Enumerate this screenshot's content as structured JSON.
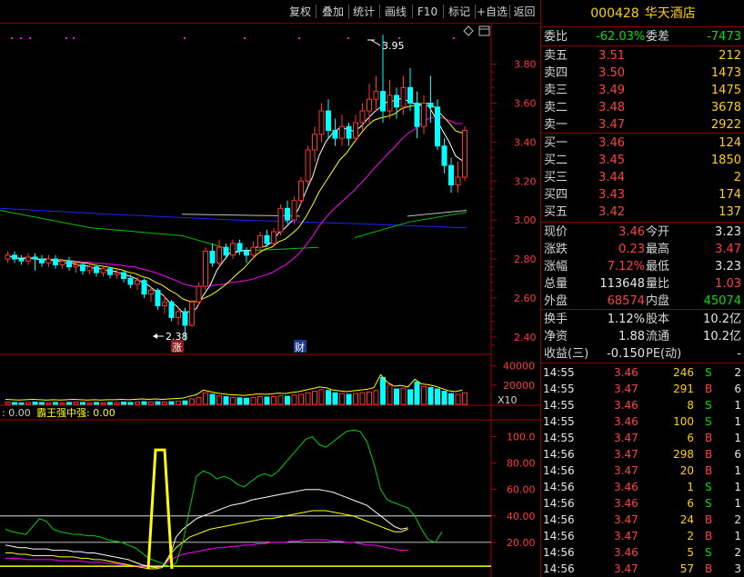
{
  "toolbar": {
    "buttons": [
      "复权",
      "叠加",
      "统计",
      "画线",
      "F10",
      "标记",
      "+自选",
      "返回"
    ]
  },
  "chart": {
    "price_axis": [
      "3.80",
      "3.60",
      "3.40",
      "3.20",
      "3.00",
      "2.80",
      "2.60",
      "2.40"
    ],
    "high_label": "3.95",
    "low_label": "2.38",
    "event_marks": [
      "涨",
      "财"
    ],
    "volume_axis": [
      "40000",
      "20000",
      "X10"
    ],
    "indicator_header_prefix": ": 0.00",
    "indicator_header_name": "霸王强中强: 0.00",
    "indicator_axis": [
      "100.0",
      "80.00",
      "60.00",
      "40.00",
      "20.00"
    ],
    "colors": {
      "up": "#ff3232",
      "down": "#00ffff",
      "ma_white": "#ffffff",
      "ma_yellow": "#ffff00",
      "ma_magenta": "#ff00ff",
      "ma_green": "#00c000",
      "ma_blue": "#2020ff"
    }
  },
  "chart_data": {
    "type": "candlestick",
    "candles": [
      [
        2.8,
        2.82,
        2.78,
        2.84
      ],
      [
        2.82,
        2.8,
        2.78,
        2.84
      ],
      [
        2.8,
        2.79,
        2.77,
        2.82
      ],
      [
        2.79,
        2.81,
        2.77,
        2.83
      ],
      [
        2.81,
        2.8,
        2.74,
        2.83
      ],
      [
        2.8,
        2.78,
        2.76,
        2.82
      ],
      [
        2.78,
        2.8,
        2.76,
        2.82
      ],
      [
        2.8,
        2.77,
        2.75,
        2.82
      ],
      [
        2.77,
        2.79,
        2.75,
        2.8
      ],
      [
        2.79,
        2.76,
        2.74,
        2.81
      ],
      [
        2.76,
        2.77,
        2.73,
        2.79
      ],
      [
        2.77,
        2.74,
        2.72,
        2.78
      ],
      [
        2.74,
        2.76,
        2.72,
        2.78
      ],
      [
        2.76,
        2.73,
        2.71,
        2.77
      ],
      [
        2.73,
        2.75,
        2.71,
        2.76
      ],
      [
        2.75,
        2.72,
        2.7,
        2.76
      ],
      [
        2.72,
        2.73,
        2.7,
        2.75
      ],
      [
        2.73,
        2.7,
        2.68,
        2.74
      ],
      [
        2.7,
        2.67,
        2.65,
        2.72
      ],
      [
        2.67,
        2.69,
        2.64,
        2.71
      ],
      [
        2.69,
        2.62,
        2.6,
        2.7
      ],
      [
        2.62,
        2.64,
        2.58,
        2.66
      ],
      [
        2.64,
        2.56,
        2.54,
        2.65
      ],
      [
        2.56,
        2.58,
        2.52,
        2.61
      ],
      [
        2.58,
        2.5,
        2.48,
        2.59
      ],
      [
        2.5,
        2.53,
        2.46,
        2.55
      ],
      [
        2.53,
        2.46,
        2.38,
        2.55
      ],
      [
        2.46,
        2.58,
        2.45,
        2.59
      ],
      [
        2.58,
        2.66,
        2.56,
        2.68
      ],
      [
        2.66,
        2.84,
        2.64,
        2.86
      ],
      [
        2.84,
        2.78,
        2.76,
        2.88
      ],
      [
        2.78,
        2.86,
        2.76,
        2.9
      ],
      [
        2.86,
        2.82,
        2.8,
        2.88
      ],
      [
        2.82,
        2.88,
        2.8,
        2.9
      ],
      [
        2.88,
        2.84,
        2.82,
        2.9
      ],
      [
        2.84,
        2.82,
        2.78,
        2.86
      ],
      [
        2.82,
        2.86,
        2.8,
        2.89
      ],
      [
        2.86,
        2.92,
        2.84,
        2.94
      ],
      [
        2.92,
        2.88,
        2.86,
        2.95
      ],
      [
        2.88,
        2.94,
        2.86,
        2.96
      ],
      [
        2.94,
        3.06,
        2.92,
        3.08
      ],
      [
        3.06,
        3.0,
        2.98,
        3.1
      ],
      [
        3.0,
        3.1,
        2.98,
        3.12
      ],
      [
        3.1,
        3.2,
        3.08,
        3.22
      ],
      [
        3.2,
        3.36,
        3.18,
        3.38
      ],
      [
        3.36,
        3.44,
        3.3,
        3.48
      ],
      [
        3.44,
        3.56,
        3.4,
        3.6
      ],
      [
        3.56,
        3.46,
        3.42,
        3.62
      ],
      [
        3.46,
        3.42,
        3.38,
        3.52
      ],
      [
        3.42,
        3.48,
        3.38,
        3.54
      ],
      [
        3.48,
        3.42,
        3.38,
        3.5
      ],
      [
        3.42,
        3.5,
        3.4,
        3.54
      ],
      [
        3.5,
        3.56,
        3.46,
        3.6
      ],
      [
        3.56,
        3.62,
        3.5,
        3.7
      ],
      [
        3.62,
        3.66,
        3.56,
        3.74
      ],
      [
        3.66,
        3.56,
        3.5,
        3.95
      ],
      [
        3.56,
        3.64,
        3.52,
        3.72
      ],
      [
        3.64,
        3.58,
        3.52,
        3.68
      ],
      [
        3.58,
        3.68,
        3.54,
        3.74
      ],
      [
        3.68,
        3.6,
        3.56,
        3.78
      ],
      [
        3.6,
        3.48,
        3.42,
        3.66
      ],
      [
        3.48,
        3.6,
        3.44,
        3.64
      ],
      [
        3.6,
        3.58,
        3.5,
        3.74
      ],
      [
        3.58,
        3.38,
        3.36,
        3.62
      ],
      [
        3.38,
        3.28,
        3.24,
        3.42
      ],
      [
        3.28,
        3.18,
        3.14,
        3.32
      ],
      [
        3.18,
        3.22,
        3.14,
        3.3
      ],
      [
        3.22,
        3.46,
        3.2,
        3.48
      ]
    ],
    "volume": [
      6,
      5,
      4,
      5,
      6,
      5,
      4,
      5,
      4,
      5,
      6,
      5,
      4,
      5,
      4,
      5,
      5,
      6,
      5,
      6,
      7,
      6,
      7,
      6,
      7,
      8,
      9,
      14,
      18,
      30,
      26,
      22,
      20,
      18,
      17,
      16,
      18,
      20,
      19,
      20,
      22,
      21,
      24,
      26,
      30,
      34,
      38,
      36,
      30,
      28,
      26,
      28,
      30,
      32,
      36,
      70,
      50,
      40,
      42,
      38,
      58,
      46,
      44,
      40,
      34,
      28,
      26,
      30
    ],
    "indicator": {
      "green": [
        30,
        28,
        27,
        26,
        32,
        38,
        36,
        30,
        28,
        27,
        26,
        26,
        25,
        25,
        24,
        22,
        21,
        20,
        18,
        16,
        12,
        8,
        6,
        4,
        2,
        4,
        20,
        45,
        70,
        74,
        72,
        68,
        70,
        68,
        64,
        62,
        66,
        70,
        72,
        70,
        74,
        80,
        86,
        92,
        98,
        100,
        94,
        92,
        96,
        100,
        104,
        105,
        104,
        96,
        80,
        60,
        52,
        50,
        48,
        46,
        40,
        30,
        22,
        20,
        28
      ],
      "white": [
        18,
        17,
        16,
        16,
        15,
        15,
        15,
        14,
        14,
        14,
        13,
        13,
        12,
        12,
        11,
        10,
        9,
        8,
        7,
        5,
        3,
        2,
        1,
        2,
        8,
        24,
        30,
        34,
        38,
        40,
        42,
        44,
        46,
        48,
        49,
        50,
        52,
        53,
        54,
        55,
        56,
        57,
        58,
        59,
        60,
        60,
        60,
        59,
        58,
        56,
        54,
        52,
        50,
        48,
        44,
        40,
        36,
        32,
        30,
        31
      ],
      "yellow": [
        12,
        12,
        11,
        11,
        10,
        10,
        10,
        10,
        9,
        9,
        9,
        8,
        8,
        7,
        7,
        6,
        5,
        4,
        3,
        2,
        1,
        0,
        0,
        1,
        10,
        16,
        20,
        24,
        26,
        28,
        30,
        31,
        32,
        33,
        34,
        35,
        36,
        37,
        38,
        38,
        39,
        40,
        41,
        42,
        43,
        44,
        44,
        44,
        43,
        42,
        41,
        40,
        38,
        36,
        34,
        32,
        30,
        28,
        28,
        30
      ],
      "magenta": [
        8,
        8,
        8,
        7,
        7,
        7,
        7,
        7,
        6,
        6,
        6,
        6,
        5,
        5,
        5,
        4,
        4,
        3,
        3,
        2,
        2,
        1,
        1,
        2,
        6,
        9,
        11,
        12,
        13,
        14,
        15,
        16,
        16,
        17,
        17,
        18,
        18,
        19,
        19,
        20,
        20,
        20,
        21,
        21,
        22,
        22,
        22,
        22,
        21,
        21,
        20,
        20,
        19,
        18,
        18,
        17,
        16,
        15,
        14,
        14
      ],
      "spike_value": 90
    },
    "price_range": [
      2.32,
      3.98
    ],
    "volume_range": [
      0,
      50000
    ],
    "indicator_range": [
      0,
      110
    ]
  },
  "quote": {
    "code": "000428",
    "name": "华天酒店",
    "weibi_label": "委比",
    "weibi_value": "-62.03%",
    "weicha_label": "委差",
    "weicha_value": "-7473",
    "sells": [
      {
        "label": "卖五",
        "price": "3.51",
        "vol": "212"
      },
      {
        "label": "卖四",
        "price": "3.50",
        "vol": "1473"
      },
      {
        "label": "卖三",
        "price": "3.49",
        "vol": "1475"
      },
      {
        "label": "卖二",
        "price": "3.48",
        "vol": "3678"
      },
      {
        "label": "卖一",
        "price": "3.47",
        "vol": "2922"
      }
    ],
    "buys": [
      {
        "label": "买一",
        "price": "3.46",
        "vol": "124"
      },
      {
        "label": "买二",
        "price": "3.45",
        "vol": "1850"
      },
      {
        "label": "买三",
        "price": "3.44",
        "vol": "2"
      },
      {
        "label": "买四",
        "price": "3.43",
        "vol": "174"
      },
      {
        "label": "买五",
        "price": "3.42",
        "vol": "137"
      }
    ],
    "stats": [
      {
        "l1": "现价",
        "v1": "3.46",
        "c1": "red",
        "l2": "今开",
        "v2": "3.23",
        "c2": "white"
      },
      {
        "l1": "涨跌",
        "v1": "0.23",
        "c1": "red",
        "l2": "最高",
        "v2": "3.47",
        "c2": "red"
      },
      {
        "l1": "涨幅",
        "v1": "7.12%",
        "c1": "red",
        "l2": "最低",
        "v2": "3.23",
        "c2": "white"
      },
      {
        "l1": "总量",
        "v1": "113648",
        "c1": "white",
        "l2": "量比",
        "v2": "1.03",
        "c2": "red"
      },
      {
        "l1": "外盘",
        "v1": "68574",
        "c1": "red",
        "l2": "内盘",
        "v2": "45074",
        "c2": "green"
      }
    ],
    "stats2": [
      {
        "l1": "换手",
        "v1": "1.12%",
        "l2": "股本",
        "v2": "10.2亿"
      },
      {
        "l1": "净资",
        "v1": "1.88",
        "l2": "流通",
        "v2": "10.2亿"
      },
      {
        "l1": "收益(三)",
        "v1": "-0.150",
        "l2": "PE(动)",
        "v2": "-"
      }
    ],
    "ticks": [
      {
        "t": "14:55",
        "p": "3.46",
        "v": "246",
        "s": "S",
        "n": "2"
      },
      {
        "t": "14:55",
        "p": "3.47",
        "v": "291",
        "s": "B",
        "n": "6"
      },
      {
        "t": "14:55",
        "p": "3.46",
        "v": "8",
        "s": "S",
        "n": "1"
      },
      {
        "t": "14:55",
        "p": "3.46",
        "v": "100",
        "s": "S",
        "n": "1"
      },
      {
        "t": "14:55",
        "p": "3.47",
        "v": "6",
        "s": "B",
        "n": "1"
      },
      {
        "t": "14:56",
        "p": "3.47",
        "v": "298",
        "s": "B",
        "n": "6"
      },
      {
        "t": "14:56",
        "p": "3.47",
        "v": "20",
        "s": "B",
        "n": "1"
      },
      {
        "t": "14:56",
        "p": "3.46",
        "v": "1",
        "s": "S",
        "n": "1"
      },
      {
        "t": "14:56",
        "p": "3.46",
        "v": "6",
        "s": "S",
        "n": "1"
      },
      {
        "t": "14:56",
        "p": "3.47",
        "v": "24",
        "s": "B",
        "n": "2"
      },
      {
        "t": "14:56",
        "p": "3.47",
        "v": "2",
        "s": "B",
        "n": "1"
      },
      {
        "t": "14:56",
        "p": "3.46",
        "v": "5",
        "s": "S",
        "n": "2"
      },
      {
        "t": "14:56",
        "p": "3.47",
        "v": "57",
        "s": "B",
        "n": "3"
      }
    ]
  }
}
